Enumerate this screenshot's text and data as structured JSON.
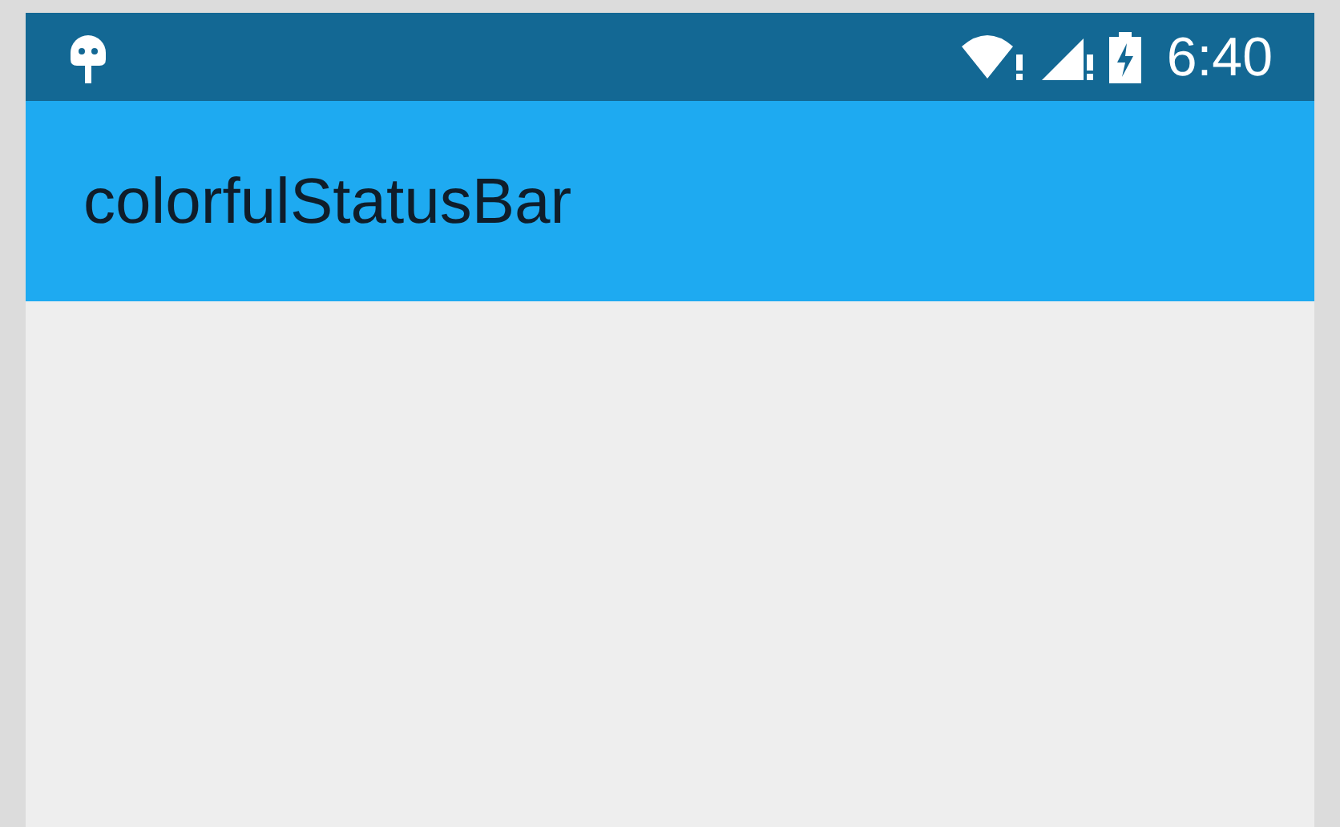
{
  "status_bar": {
    "time": "6:40"
  },
  "app_bar": {
    "title": "colorfulStatusBar"
  }
}
